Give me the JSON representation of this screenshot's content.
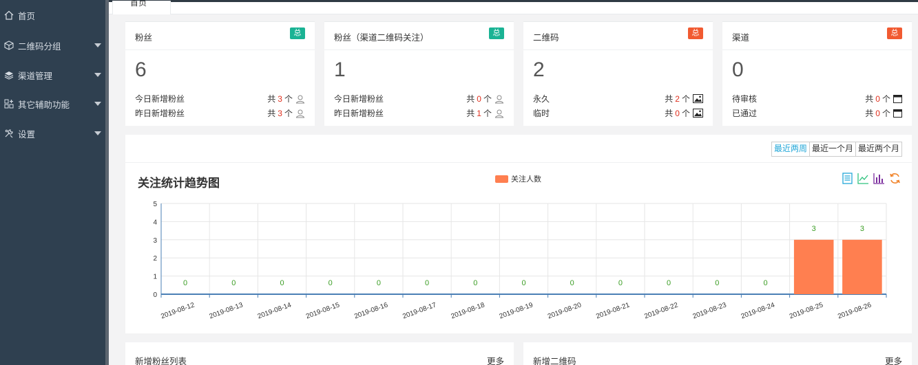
{
  "sidebar": {
    "items": [
      {
        "label": "首页",
        "icon": "home-icon"
      },
      {
        "label": "二维码分组",
        "icon": "cube-icon"
      },
      {
        "label": "渠道管理",
        "icon": "layers-icon"
      },
      {
        "label": "其它辅助功能",
        "icon": "apps-icon"
      },
      {
        "label": "设置",
        "icon": "tools-icon"
      }
    ]
  },
  "tabs": [
    {
      "label": "首页"
    }
  ],
  "cards": [
    {
      "title": "粉丝",
      "badge": "总",
      "badge_color": "#1ab394",
      "big": "6",
      "rows": [
        {
          "label": "今日新增粉丝",
          "prefix": "共",
          "num": "3",
          "suffix": "个",
          "icon": "user-icon"
        },
        {
          "label": "昨日新增粉丝",
          "prefix": "共",
          "num": "3",
          "suffix": "个",
          "icon": "user-icon"
        }
      ]
    },
    {
      "title": "粉丝（渠道二维码关注）",
      "badge": "总",
      "badge_color": "#1ab394",
      "big": "1",
      "rows": [
        {
          "label": "今日新增粉丝",
          "prefix": "共",
          "num": "0",
          "suffix": "个",
          "icon": "user-icon"
        },
        {
          "label": "昨日新增粉丝",
          "prefix": "共",
          "num": "1",
          "suffix": "个",
          "icon": "user-icon"
        }
      ]
    },
    {
      "title": "二维码",
      "badge": "总",
      "badge_color": "#f15a31",
      "big": "2",
      "rows": [
        {
          "label": "永久",
          "prefix": "共",
          "num": "2",
          "suffix": "个",
          "icon": "image-icon"
        },
        {
          "label": "临时",
          "prefix": "共",
          "num": "0",
          "suffix": "个",
          "icon": "image-icon"
        }
      ]
    },
    {
      "title": "渠道",
      "badge": "总",
      "badge_color": "#f15a31",
      "big": "0",
      "rows": [
        {
          "label": "待审核",
          "prefix": "共",
          "num": "0",
          "suffix": "个",
          "icon": "window-icon"
        },
        {
          "label": "已通过",
          "prefix": "共",
          "num": "0",
          "suffix": "个",
          "icon": "window-icon"
        }
      ]
    }
  ],
  "range_buttons": [
    "最近两周",
    "最近一个月",
    "最近两个月"
  ],
  "chart_title": "关注统计趋势图",
  "toolbox": [
    "data-view-icon",
    "line-chart-icon",
    "bar-chart-icon",
    "refresh-icon"
  ],
  "colors": {
    "bar": "#ff7f50",
    "label": "#3a9d23",
    "badge_green": "#1ab394",
    "badge_orange": "#f15a31"
  },
  "chart_data": {
    "type": "bar",
    "title": "关注统计趋势图",
    "categories": [
      "2019-08-12",
      "2019-08-13",
      "2019-08-14",
      "2019-08-15",
      "2019-08-16",
      "2019-08-17",
      "2019-08-18",
      "2019-08-19",
      "2019-08-20",
      "2019-08-21",
      "2019-08-22",
      "2019-08-23",
      "2019-08-24",
      "2019-08-25",
      "2019-08-26"
    ],
    "series": [
      {
        "name": "关注人数",
        "values": [
          0,
          0,
          0,
          0,
          0,
          0,
          0,
          0,
          0,
          0,
          0,
          0,
          0,
          3,
          3
        ]
      }
    ],
    "ylim": [
      0,
      5
    ],
    "yticks": [
      0,
      1,
      2,
      3,
      4,
      5
    ],
    "grid": true,
    "legend": "top-center",
    "data_labels": true
  },
  "bottom": [
    {
      "title": "新增粉丝列表",
      "more": "更多"
    },
    {
      "title": "新增二维码",
      "more": "更多"
    }
  ]
}
